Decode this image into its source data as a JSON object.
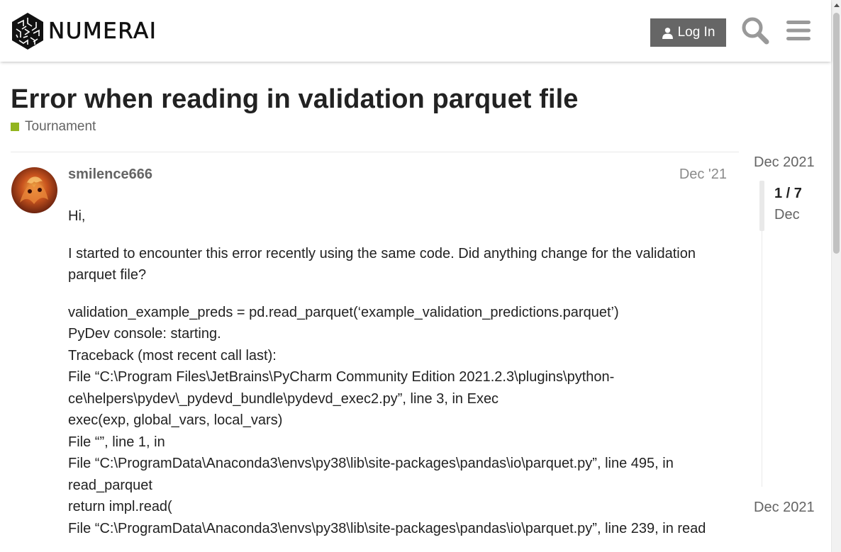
{
  "header": {
    "logo_text": "NUMERAI",
    "login_label": "Log In",
    "icons": [
      "numerai-logo-icon",
      "user-icon",
      "search-icon",
      "hamburger-menu-icon"
    ]
  },
  "topic": {
    "title": "Error when reading in validation parquet file",
    "category": "Tournament",
    "category_color": "#92B51F"
  },
  "post": {
    "username": "smilence666",
    "date": "Dec '21",
    "greeting": "Hi,",
    "intro": "I started to encounter this error recently using the same code. Did anything change for the validation parquet file?",
    "code_lines": [
      "validation_example_preds = pd.read_parquet(‘example_validation_predictions.parquet’)",
      "PyDev console: starting.",
      "Traceback (most recent call last):",
      "File “C:\\Program Files\\JetBrains\\PyCharm Community Edition 2021.2.3\\plugins\\python-ce\\helpers\\pydev\\_pydevd_bundle\\pydevd_exec2.py”, line 3, in Exec",
      "exec(exp, global_vars, local_vars)",
      "File “”, line 1, in",
      "File “C:\\ProgramData\\Anaconda3\\envs\\py38\\lib\\site-packages\\pandas\\io\\parquet.py”, line 495, in read_parquet",
      "return impl.read(",
      "File “C:\\ProgramData\\Anaconda3\\envs\\py38\\lib\\site-packages\\pandas\\io\\parquet.py”, line 239, in read"
    ]
  },
  "timeline": {
    "start_date": "Dec 2021",
    "position": "1 / 7",
    "current_date": "Dec",
    "end_date": "Dec 2021"
  },
  "colors": {
    "button_bg": "#666666",
    "text_muted": "#646464",
    "link_muted": "#8a8a8a"
  }
}
